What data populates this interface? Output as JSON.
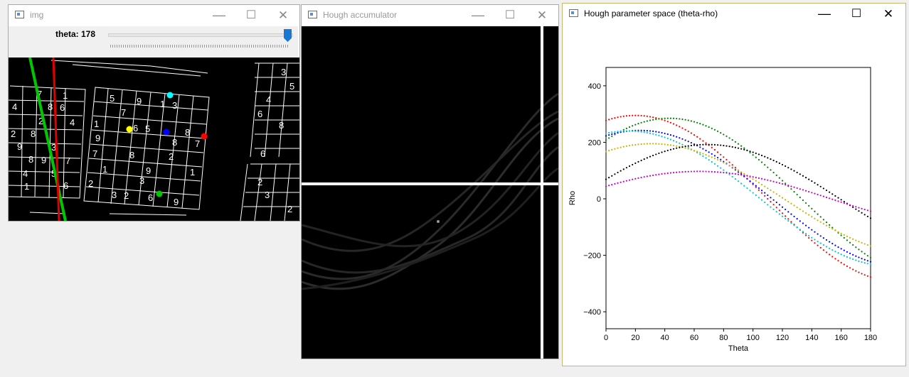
{
  "windows": {
    "img": {
      "title": "img",
      "trackbar": {
        "label": "theta: 178",
        "value": 178,
        "max": 180
      }
    },
    "accumulator": {
      "title": "Hough accumulator"
    },
    "plot": {
      "title": "Hough parameter space (theta-rho)"
    }
  },
  "titlebar_glyphs": {
    "minimize": "—",
    "maximize": "☐",
    "close": "✕"
  },
  "chart_data": {
    "type": "scatter",
    "xlabel": "Theta",
    "ylabel": "Rho",
    "xlim": [
      0,
      180
    ],
    "ylim": [
      -460,
      465
    ],
    "xticks": [
      0,
      20,
      40,
      60,
      80,
      100,
      120,
      140,
      160,
      180
    ],
    "yticks": [
      -400,
      -200,
      0,
      200,
      400
    ],
    "grid": false,
    "series": [
      {
        "color": "#ff0000",
        "curve": {
          "amplitude": 295,
          "peak_theta": 20
        }
      },
      {
        "color": "#008000",
        "curve": {
          "amplitude": 285,
          "peak_theta": 43
        }
      },
      {
        "color": "#0000ff",
        "curve": {
          "amplitude": 242,
          "peak_theta": 23
        }
      },
      {
        "color": "#00c8c8",
        "curve": {
          "amplitude": 240,
          "peak_theta": 15
        }
      },
      {
        "color": "#c8b400",
        "curve": {
          "amplitude": 195,
          "peak_theta": 31
        }
      },
      {
        "color": "#000000",
        "curve": {
          "amplitude": 192,
          "peak_theta": 69
        }
      },
      {
        "color": "#c800c8",
        "curve": {
          "amplitude": 97,
          "peak_theta": 63
        }
      }
    ]
  }
}
